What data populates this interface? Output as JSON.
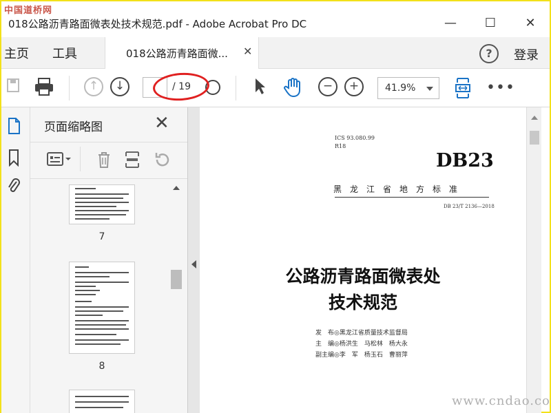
{
  "watermark_top": "中国道桥网",
  "window": {
    "title": "018公路沥青路面微表处技术规范.pdf - Adobe Acrobat Pro DC",
    "minimize_icon": "minimize-icon",
    "maximize_icon": "maximize-icon",
    "close_icon": "close-icon"
  },
  "tabs": {
    "home": "主页",
    "tools": "工具",
    "document": "018公路沥青路面微...",
    "help": "?",
    "login": "登录"
  },
  "toolbar": {
    "page_current": "",
    "page_total": "/ 19",
    "zoom": "41.9%"
  },
  "panel": {
    "title": "页面缩略图",
    "thumbnails": [
      {
        "label": "7"
      },
      {
        "label": "8"
      }
    ]
  },
  "document": {
    "ics": "ICS 93.080.99",
    "r18": "R18",
    "standard_code": "DB23",
    "province": "黑　龙　江　省　地　方　标　准",
    "standard_number": "DB 23/T 2136—2018",
    "title_line1": "公路沥青路面微表处",
    "title_line2": "技术规范",
    "issuer": "发　布◎黑龙江省质量技术监督局",
    "editor": "主　编◎杨洪生　马松林　杨大永",
    "vice_editor": "副主编◎李　军　杨玉石　曹丽萍"
  },
  "watermark_bottom": "www.cndao.com"
}
